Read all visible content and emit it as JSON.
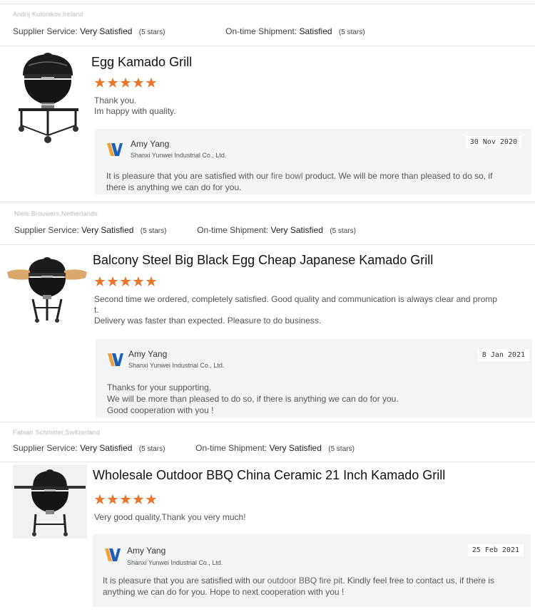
{
  "colors": {
    "star": "#e8762c",
    "logo_blue": "#1f5fb5",
    "logo_orange": "#f0a23a"
  },
  "labels": {
    "supplier_service": "Supplier Service:",
    "on_time_shipment": "On-time Shipment:"
  },
  "reviews": [
    {
      "reviewer": "Andrij Kulonikov,Ireland",
      "supplier_value": "Very Satisfied",
      "supplier_stars": "(5 stars)",
      "shipment_value": "Satisfied",
      "shipment_stars": "(5 stars)",
      "title": "Egg Kamado Grill",
      "rating": 5,
      "comment": [
        "Thank you.",
        "Im happy with quality."
      ],
      "reply": {
        "name": "Amy Yang",
        "company": "Shanxi Yunwei Industrial Co., Ltd.",
        "date": "30 Nov 2020",
        "text_before": "It is pleasure that you are satisfied with our",
        "keyword": "fire bowl",
        "text_after": "product. We will be more than pleased to do so, if there is anything we can do for you."
      }
    },
    {
      "reviewer": "Niels Brouwers,Netherlands",
      "supplier_value": "Very Satisfied",
      "supplier_stars": "(5 stars)",
      "shipment_value": "Very Satisfied",
      "shipment_stars": "(5 stars)",
      "title": "Balcony Steel Big Black Egg Cheap Japanese Kamado Grill",
      "rating": 5,
      "comment": [
        "Second time we ordered, completely satisfied. Good quality and communication is always clear and promp",
        "t.",
        "Delivery was faster than expected. Pleasure to do business."
      ],
      "reply": {
        "name": "Amy Yang",
        "company": "Shanxi Yunwei Industrial Co., Ltd.",
        "date": "8 Jan 2021",
        "lines": [
          "Thanks for your supporting.",
          "We will be more than pleased to do so, if there is anything we can do for you.",
          "Good cooperation with you !"
        ]
      }
    },
    {
      "reviewer": "Fabian Schmitter,Switzerland",
      "supplier_value": "Very Satisfied",
      "supplier_stars": "(5 stars)",
      "shipment_value": "Very Satisfied",
      "shipment_stars": "(5 stars)",
      "title": "Wholesale  Outdoor BBQ China Ceramic 21 Inch Kamado Grill",
      "rating": 5,
      "comment": [
        "Very good quality,Thank you very much!"
      ],
      "reply": {
        "name": "Amy Yang",
        "company": "Shanxi Yunwei Industrial Co., Ltd.",
        "date": "25 Feb 2021",
        "text_before": "It is pleasure that you are satisfied with our",
        "keyword": "outdoor BBQ fire pit.",
        "text_after": "Kindly feel free to contact us, if there is anything we can do for you. Hope to next cooperation with you !"
      }
    }
  ]
}
